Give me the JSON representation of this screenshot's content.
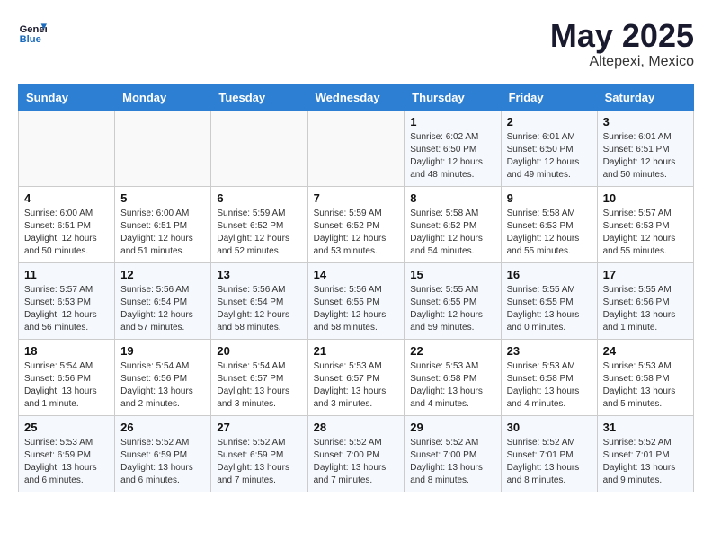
{
  "header": {
    "logo_general": "General",
    "logo_blue": "Blue",
    "month": "May 2025",
    "location": "Altepexi, Mexico"
  },
  "weekdays": [
    "Sunday",
    "Monday",
    "Tuesday",
    "Wednesday",
    "Thursday",
    "Friday",
    "Saturday"
  ],
  "weeks": [
    [
      {
        "day": "",
        "sunrise": "",
        "sunset": "",
        "daylight": ""
      },
      {
        "day": "",
        "sunrise": "",
        "sunset": "",
        "daylight": ""
      },
      {
        "day": "",
        "sunrise": "",
        "sunset": "",
        "daylight": ""
      },
      {
        "day": "",
        "sunrise": "",
        "sunset": "",
        "daylight": ""
      },
      {
        "day": "1",
        "sunrise": "6:02 AM",
        "sunset": "6:50 PM",
        "daylight": "12 hours and 48 minutes."
      },
      {
        "day": "2",
        "sunrise": "6:01 AM",
        "sunset": "6:50 PM",
        "daylight": "12 hours and 49 minutes."
      },
      {
        "day": "3",
        "sunrise": "6:01 AM",
        "sunset": "6:51 PM",
        "daylight": "12 hours and 50 minutes."
      }
    ],
    [
      {
        "day": "4",
        "sunrise": "6:00 AM",
        "sunset": "6:51 PM",
        "daylight": "12 hours and 50 minutes."
      },
      {
        "day": "5",
        "sunrise": "6:00 AM",
        "sunset": "6:51 PM",
        "daylight": "12 hours and 51 minutes."
      },
      {
        "day": "6",
        "sunrise": "5:59 AM",
        "sunset": "6:52 PM",
        "daylight": "12 hours and 52 minutes."
      },
      {
        "day": "7",
        "sunrise": "5:59 AM",
        "sunset": "6:52 PM",
        "daylight": "12 hours and 53 minutes."
      },
      {
        "day": "8",
        "sunrise": "5:58 AM",
        "sunset": "6:52 PM",
        "daylight": "12 hours and 54 minutes."
      },
      {
        "day": "9",
        "sunrise": "5:58 AM",
        "sunset": "6:53 PM",
        "daylight": "12 hours and 55 minutes."
      },
      {
        "day": "10",
        "sunrise": "5:57 AM",
        "sunset": "6:53 PM",
        "daylight": "12 hours and 55 minutes."
      }
    ],
    [
      {
        "day": "11",
        "sunrise": "5:57 AM",
        "sunset": "6:53 PM",
        "daylight": "12 hours and 56 minutes."
      },
      {
        "day": "12",
        "sunrise": "5:56 AM",
        "sunset": "6:54 PM",
        "daylight": "12 hours and 57 minutes."
      },
      {
        "day": "13",
        "sunrise": "5:56 AM",
        "sunset": "6:54 PM",
        "daylight": "12 hours and 58 minutes."
      },
      {
        "day": "14",
        "sunrise": "5:56 AM",
        "sunset": "6:55 PM",
        "daylight": "12 hours and 58 minutes."
      },
      {
        "day": "15",
        "sunrise": "5:55 AM",
        "sunset": "6:55 PM",
        "daylight": "12 hours and 59 minutes."
      },
      {
        "day": "16",
        "sunrise": "5:55 AM",
        "sunset": "6:55 PM",
        "daylight": "13 hours and 0 minutes."
      },
      {
        "day": "17",
        "sunrise": "5:55 AM",
        "sunset": "6:56 PM",
        "daylight": "13 hours and 1 minute."
      }
    ],
    [
      {
        "day": "18",
        "sunrise": "5:54 AM",
        "sunset": "6:56 PM",
        "daylight": "13 hours and 1 minute."
      },
      {
        "day": "19",
        "sunrise": "5:54 AM",
        "sunset": "6:56 PM",
        "daylight": "13 hours and 2 minutes."
      },
      {
        "day": "20",
        "sunrise": "5:54 AM",
        "sunset": "6:57 PM",
        "daylight": "13 hours and 3 minutes."
      },
      {
        "day": "21",
        "sunrise": "5:53 AM",
        "sunset": "6:57 PM",
        "daylight": "13 hours and 3 minutes."
      },
      {
        "day": "22",
        "sunrise": "5:53 AM",
        "sunset": "6:58 PM",
        "daylight": "13 hours and 4 minutes."
      },
      {
        "day": "23",
        "sunrise": "5:53 AM",
        "sunset": "6:58 PM",
        "daylight": "13 hours and 4 minutes."
      },
      {
        "day": "24",
        "sunrise": "5:53 AM",
        "sunset": "6:58 PM",
        "daylight": "13 hours and 5 minutes."
      }
    ],
    [
      {
        "day": "25",
        "sunrise": "5:53 AM",
        "sunset": "6:59 PM",
        "daylight": "13 hours and 6 minutes."
      },
      {
        "day": "26",
        "sunrise": "5:52 AM",
        "sunset": "6:59 PM",
        "daylight": "13 hours and 6 minutes."
      },
      {
        "day": "27",
        "sunrise": "5:52 AM",
        "sunset": "6:59 PM",
        "daylight": "13 hours and 7 minutes."
      },
      {
        "day": "28",
        "sunrise": "5:52 AM",
        "sunset": "7:00 PM",
        "daylight": "13 hours and 7 minutes."
      },
      {
        "day": "29",
        "sunrise": "5:52 AM",
        "sunset": "7:00 PM",
        "daylight": "13 hours and 8 minutes."
      },
      {
        "day": "30",
        "sunrise": "5:52 AM",
        "sunset": "7:01 PM",
        "daylight": "13 hours and 8 minutes."
      },
      {
        "day": "31",
        "sunrise": "5:52 AM",
        "sunset": "7:01 PM",
        "daylight": "13 hours and 9 minutes."
      }
    ]
  ]
}
